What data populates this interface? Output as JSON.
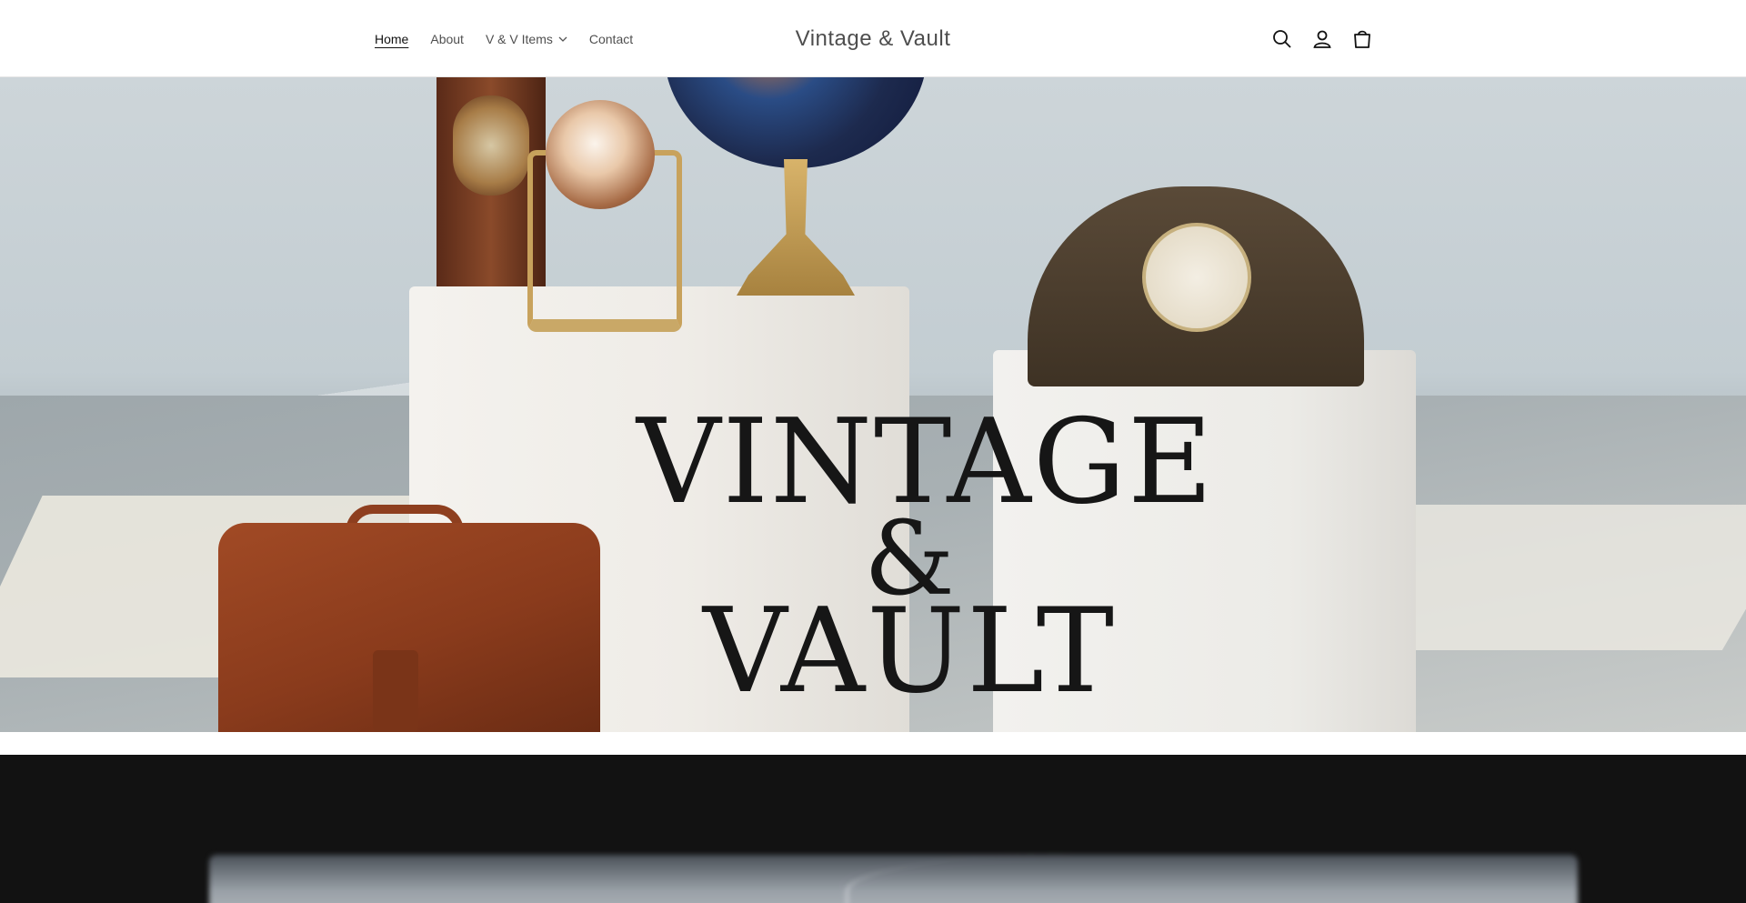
{
  "header": {
    "brand": "Vintage & Vault",
    "nav": [
      {
        "label": "Home",
        "active": true
      },
      {
        "label": "About"
      },
      {
        "label": "V & V Items",
        "has_dropdown": true
      },
      {
        "label": "Contact"
      }
    ],
    "icons": [
      "search-icon",
      "account-icon",
      "cart-icon"
    ]
  },
  "hero": {
    "title_line1": "VINTAGE",
    "title_amp": "&",
    "title_line2": "VAULT"
  },
  "colors": {
    "text": "#121212",
    "nav_text": "#5a5a5a",
    "dark_section": "#121212"
  }
}
